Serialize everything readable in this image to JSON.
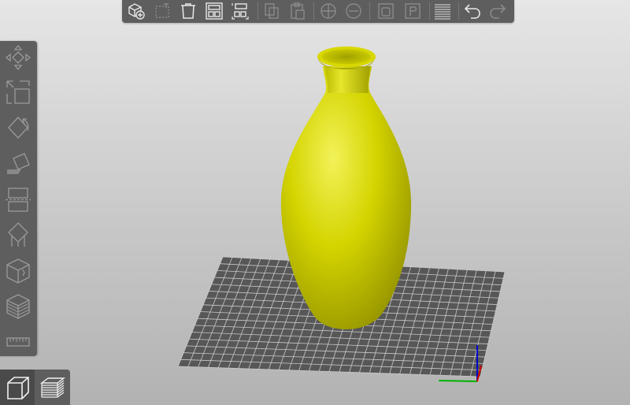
{
  "scene": {
    "model_color": "#d4d400",
    "model_highlight": "#f2f25a",
    "model_shadow": "#8f8f00",
    "bed_color": "#575757",
    "grid_color": "#c9c9c9",
    "axis_x_color": "#00b000",
    "axis_y_color": "#d00000",
    "axis_z_color": "#0000d0"
  },
  "top_toolbar": {
    "buttons": [
      {
        "id": "add",
        "icon": "add-object-icon",
        "enabled": true
      },
      {
        "id": "delete",
        "icon": "delete-icon",
        "enabled": false
      },
      {
        "id": "delete-all",
        "icon": "delete-all-icon",
        "enabled": true
      },
      {
        "id": "arrange",
        "icon": "arrange-icon",
        "enabled": true
      },
      {
        "id": "arrange-selection",
        "icon": "arrange-selection-icon",
        "enabled": true
      },
      {
        "id": "copy",
        "icon": "copy-icon",
        "enabled": false
      },
      {
        "id": "paste",
        "icon": "paste-icon",
        "enabled": false
      },
      {
        "id": "add-instance",
        "icon": "add-instance-icon",
        "enabled": false
      },
      {
        "id": "remove-instance",
        "icon": "remove-instance-icon",
        "enabled": false
      },
      {
        "id": "split-objects",
        "icon": "split-objects-icon",
        "enabled": false
      },
      {
        "id": "split-parts",
        "icon": "split-parts-icon",
        "enabled": false
      },
      {
        "id": "layers-editing",
        "icon": "layers-editing-icon",
        "enabled": false
      },
      {
        "id": "undo",
        "icon": "undo-icon",
        "enabled": true
      },
      {
        "id": "redo",
        "icon": "redo-icon",
        "enabled": false
      }
    ]
  },
  "left_toolbar": {
    "buttons": [
      {
        "id": "move",
        "icon": "move-icon"
      },
      {
        "id": "scale",
        "icon": "scale-icon"
      },
      {
        "id": "rotate",
        "icon": "rotate-icon"
      },
      {
        "id": "place-on-face",
        "icon": "place-on-face-icon"
      },
      {
        "id": "cut",
        "icon": "cut-icon"
      },
      {
        "id": "support-points",
        "icon": "support-points-icon"
      },
      {
        "id": "seam-painting",
        "icon": "seam-painting-icon"
      },
      {
        "id": "variable-layer-height",
        "icon": "variable-layer-height-icon"
      },
      {
        "id": "measure",
        "icon": "measure-icon"
      }
    ]
  },
  "view_switcher": {
    "buttons": [
      {
        "id": "3d-view",
        "icon": "3d-view-icon",
        "active": true
      },
      {
        "id": "preview",
        "icon": "preview-layers-icon",
        "active": false
      }
    ]
  }
}
